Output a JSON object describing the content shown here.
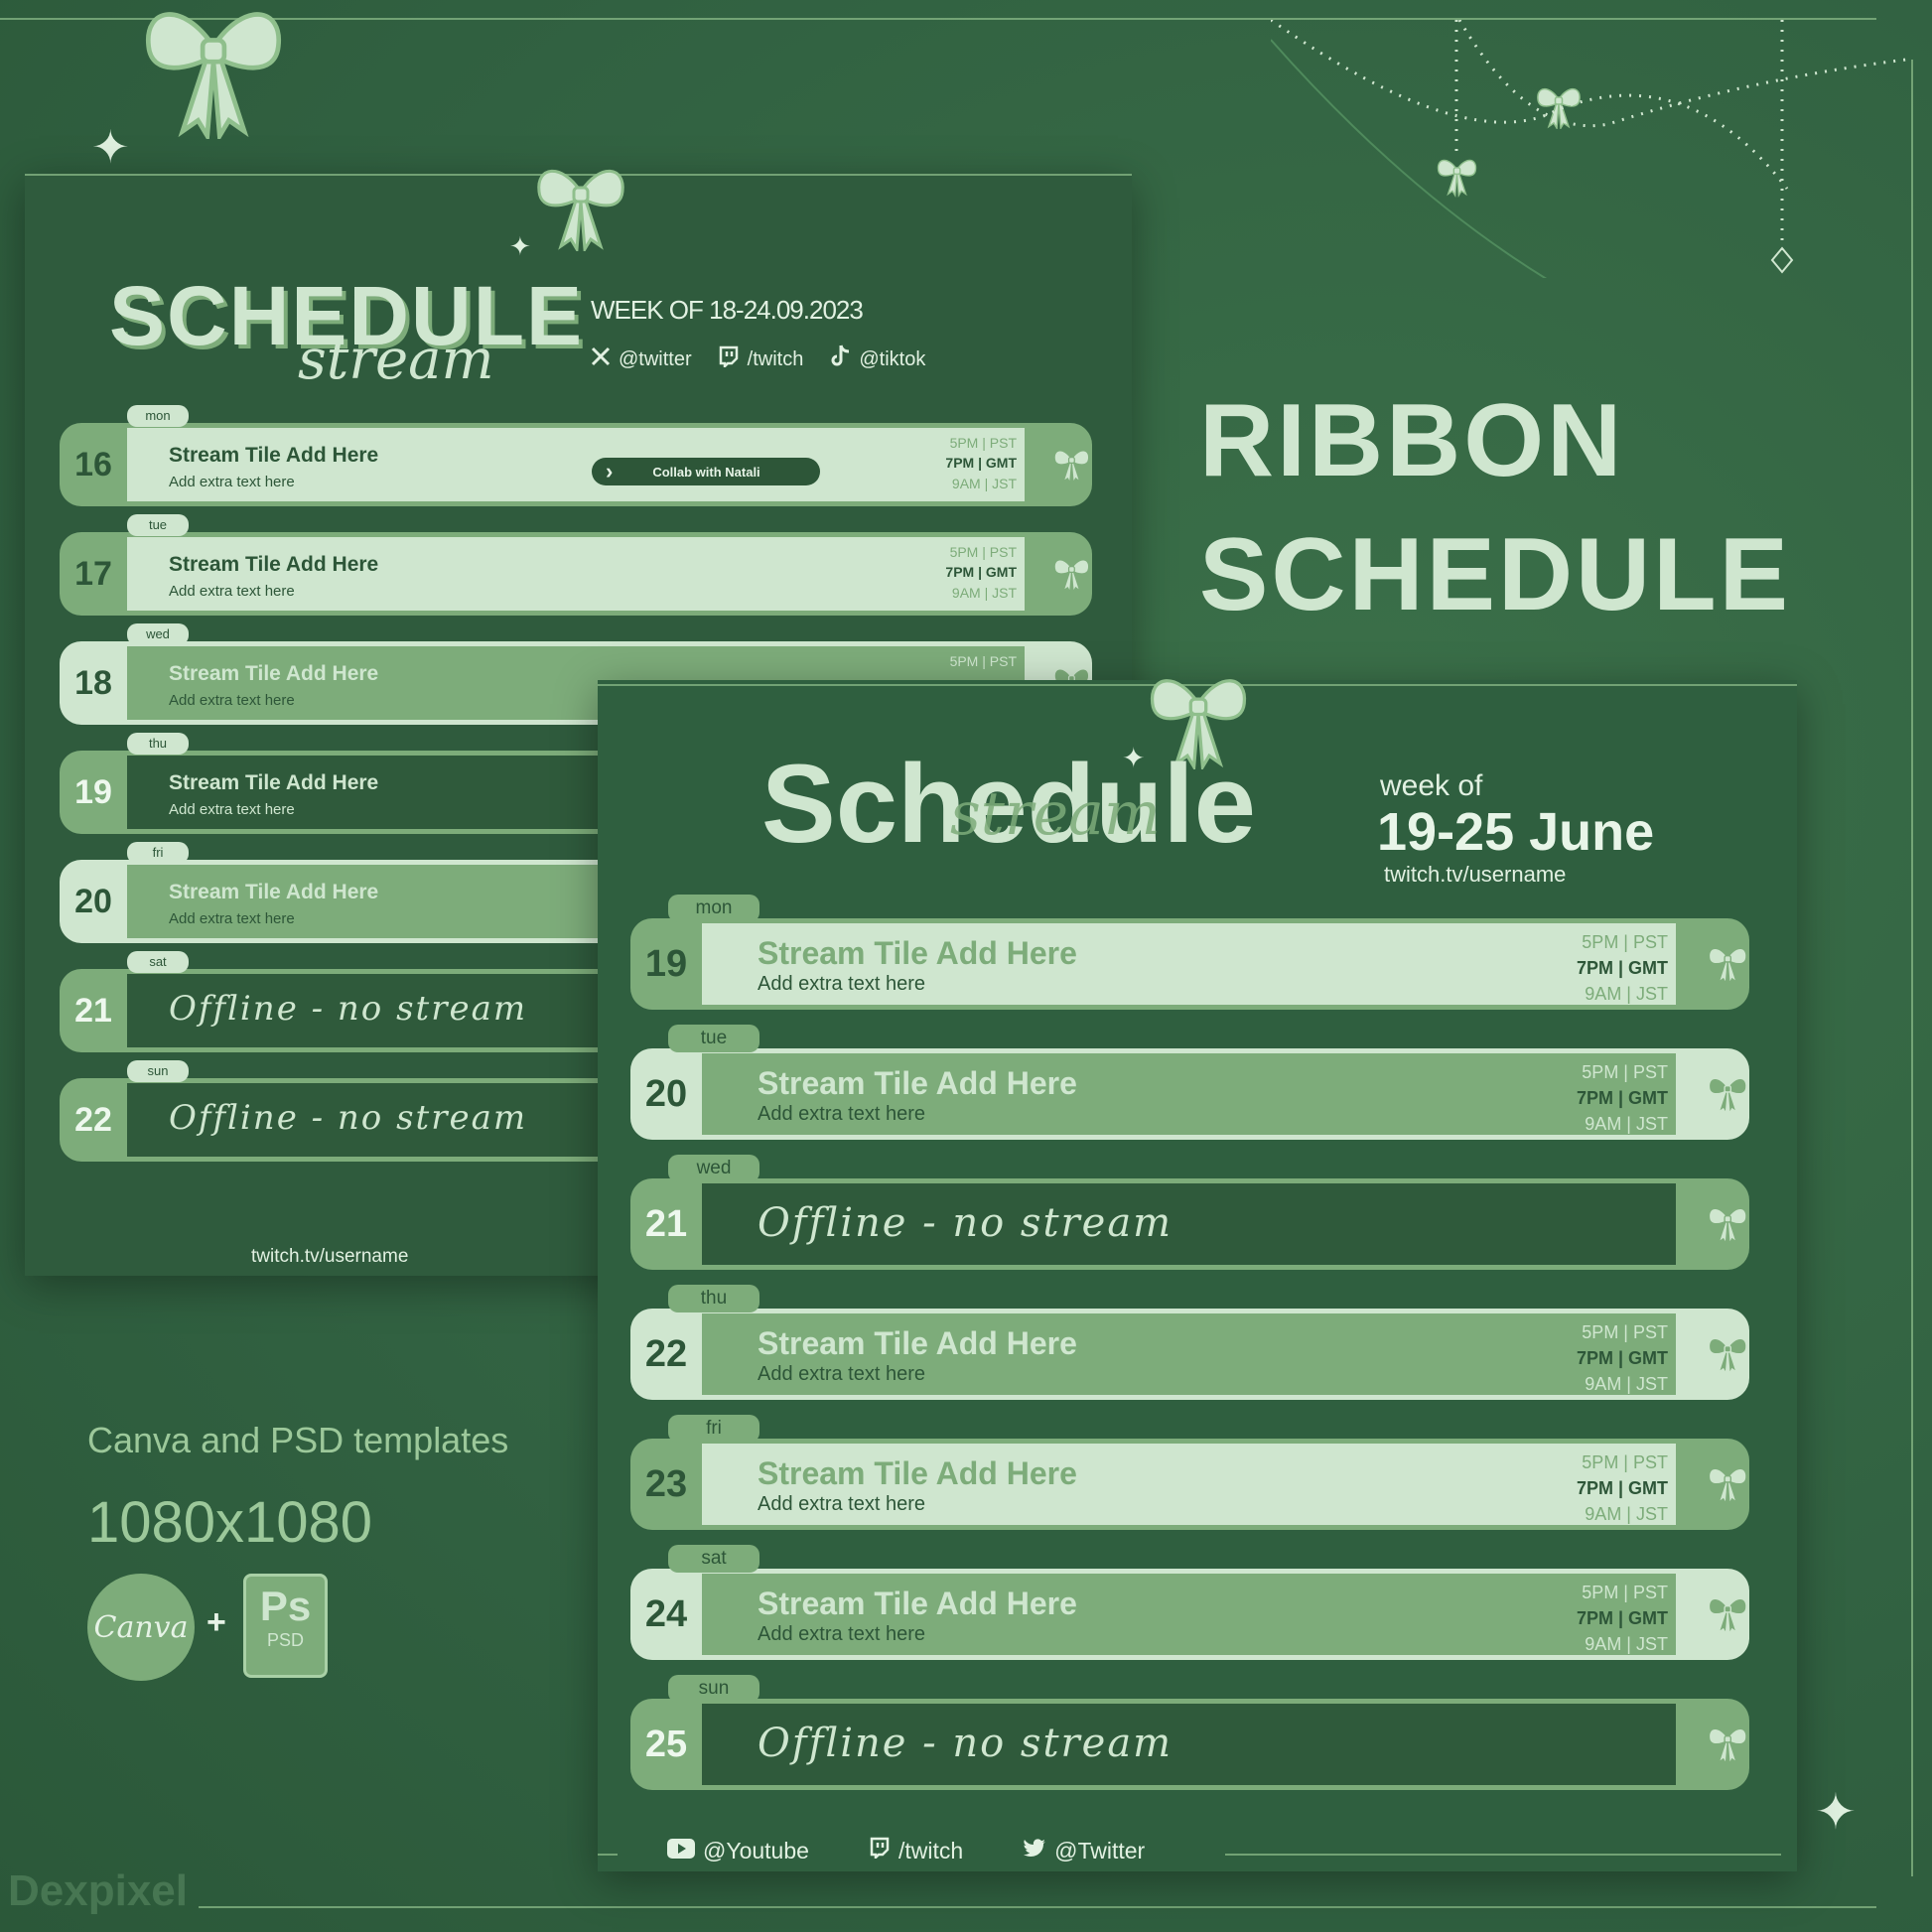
{
  "colors": {
    "background": "#316141",
    "card": "#2f5b3d",
    "light": "#cfe6cf",
    "mid": "#7dac7a",
    "dark": "#2f5a3b",
    "ink": "#2d5638"
  },
  "promo": {
    "title_line1": "RIBBON",
    "title_line2": "SCHEDULE",
    "formats": "Canva and PSD templates",
    "size": "1080x1080",
    "canva_label": "Canva",
    "plus": "+",
    "ps_label": "Ps",
    "psd_label": "PSD",
    "watermark": "Dexpixel"
  },
  "back": {
    "title": "SCHEDULE",
    "script": "stream",
    "week": "WEEK OF 18-24.09.2023",
    "socials": [
      {
        "icon": "x-icon",
        "label": "@twitter"
      },
      {
        "icon": "twitch-icon",
        "label": "/twitch"
      },
      {
        "icon": "tiktok-icon",
        "label": "@tiktok"
      }
    ],
    "rows": [
      {
        "day": "mon",
        "date": "16",
        "variant": "light",
        "title": "Stream Tile Add Here",
        "sub": "Add extra text here",
        "times": [
          "5PM | PST",
          "7PM | GMT",
          "9AM | JST"
        ],
        "badge": "Collab with Natali"
      },
      {
        "day": "tue",
        "date": "17",
        "variant": "light",
        "title": "Stream Tile Add Here",
        "sub": "Add extra text here",
        "times": [
          "5PM | PST",
          "7PM | GMT",
          "9AM | JST"
        ]
      },
      {
        "day": "wed",
        "date": "18",
        "variant": "mid",
        "title": "Stream Tile Add Here",
        "sub": "Add extra text here",
        "times": [
          "5PM | PST"
        ]
      },
      {
        "day": "thu",
        "date": "19",
        "variant": "dark",
        "title": "Stream Tile Add Here",
        "sub": "Add extra text here"
      },
      {
        "day": "fri",
        "date": "20",
        "variant": "mid",
        "title": "Stream Tile Add Here",
        "sub": "Add extra text here"
      },
      {
        "day": "sat",
        "date": "21",
        "variant": "offline",
        "script": "Offline - no stream"
      },
      {
        "day": "sun",
        "date": "22",
        "variant": "offline",
        "script": "Offline - no stream"
      }
    ],
    "footer": "twitch.tv/username"
  },
  "front": {
    "title": "Schedule",
    "script": "stream",
    "week_label": "week of",
    "week_range": "19-25 June",
    "channel": "twitch.tv/username",
    "rows": [
      {
        "day": "mon",
        "date": "19",
        "variant": "light",
        "title": "Stream Tile Add Here",
        "sub": "Add extra text here",
        "times": [
          "5PM | PST",
          "7PM | GMT",
          "9AM | JST"
        ]
      },
      {
        "day": "tue",
        "date": "20",
        "variant": "mid",
        "title": "Stream Tile Add Here",
        "sub": "Add extra text here",
        "times": [
          "5PM | PST",
          "7PM | GMT",
          "9AM | JST"
        ]
      },
      {
        "day": "wed",
        "date": "21",
        "variant": "offline",
        "script": "Offline - no stream"
      },
      {
        "day": "thu",
        "date": "22",
        "variant": "mid",
        "title": "Stream Tile Add Here",
        "sub": "Add extra text here",
        "times": [
          "5PM | PST",
          "7PM | GMT",
          "9AM | JST"
        ]
      },
      {
        "day": "fri",
        "date": "23",
        "variant": "light",
        "title": "Stream Tile Add Here",
        "sub": "Add extra text here",
        "times": [
          "5PM | PST",
          "7PM | GMT",
          "9AM | JST"
        ]
      },
      {
        "day": "sat",
        "date": "24",
        "variant": "mid",
        "title": "Stream Tile Add Here",
        "sub": "Add extra text here",
        "times": [
          "5PM | PST",
          "7PM | GMT",
          "9AM | JST"
        ]
      },
      {
        "day": "sun",
        "date": "25",
        "variant": "offline",
        "script": "Offline - no stream"
      }
    ],
    "footer": [
      {
        "icon": "youtube-icon",
        "label": "@Youtube"
      },
      {
        "icon": "twitch-icon",
        "label": "/twitch"
      },
      {
        "icon": "twitter-bird-icon",
        "label": "@Twitter"
      }
    ]
  }
}
